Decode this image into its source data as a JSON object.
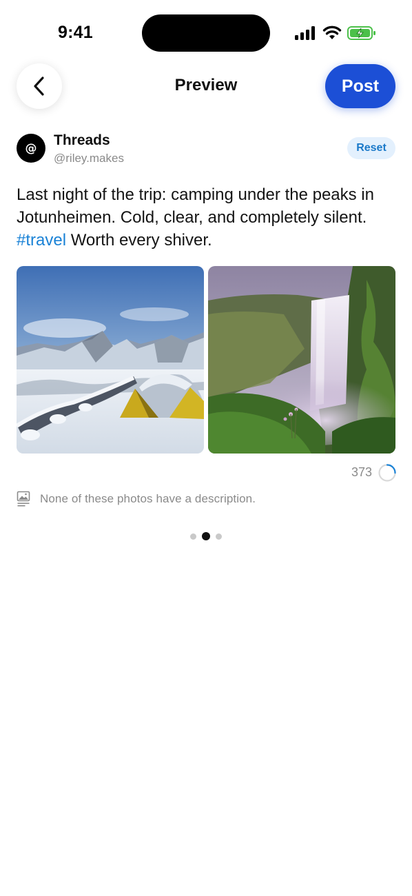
{
  "status_bar": {
    "time": "9:41"
  },
  "header": {
    "title": "Preview",
    "post_label": "Post"
  },
  "account": {
    "name": "Threads",
    "handle": "@riley.makes",
    "avatar_glyph": "@",
    "reset_label": "Reset"
  },
  "post": {
    "text_before": "Last night of the trip: camping under the peaks in Jotunheimen. Cold, clear, and completely silent. ",
    "hashtag": "#travel",
    "text_after": " Worth every shiver."
  },
  "images": [
    {
      "icon": "snow-camp-photo"
    },
    {
      "icon": "waterfall-photo"
    }
  ],
  "composer": {
    "char_count": "373",
    "progress_fraction": 0.25,
    "alt_text_notice": "None of these photos have a description."
  },
  "pagination": {
    "total": 3,
    "active": 1
  },
  "colors": {
    "accent": "#1c4fd6",
    "hashtag": "#1a82d6",
    "reset_bg": "#e3f0fd",
    "reset_text": "#1a79c9",
    "muted": "#8a8a8a"
  }
}
